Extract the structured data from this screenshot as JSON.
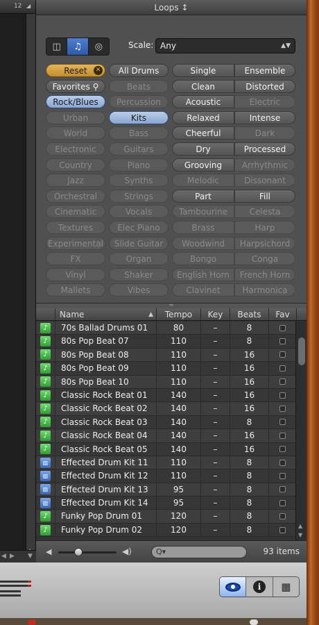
{
  "window": {
    "title": "Loops ↕"
  },
  "left_strip": {
    "col_number": "12"
  },
  "toolbar": {
    "view_buttons": [
      {
        "name": "column-view",
        "glyph": "◫",
        "active": false
      },
      {
        "name": "music-view",
        "glyph": "♫",
        "active": true
      },
      {
        "name": "podcast-view",
        "glyph": "◎",
        "active": false
      }
    ],
    "scale_label": "Scale:",
    "scale_value": "Any",
    "scale_arrows": "▲▼"
  },
  "keywords": {
    "col1": [
      {
        "label": "Reset",
        "state": "reset"
      },
      {
        "label": "Favorites",
        "state": "on"
      },
      {
        "label": "Rock/Blues",
        "state": "sel"
      },
      {
        "label": "Urban",
        "state": "off"
      },
      {
        "label": "World",
        "state": "off"
      },
      {
        "label": "Electronic",
        "state": "off"
      },
      {
        "label": "Country",
        "state": "off"
      },
      {
        "label": "Jazz",
        "state": "off"
      },
      {
        "label": "Orchestral",
        "state": "off"
      },
      {
        "label": "Cinematic",
        "state": "off"
      },
      {
        "label": "Textures",
        "state": "off"
      },
      {
        "label": "Experimental",
        "state": "off"
      },
      {
        "label": "FX",
        "state": "off"
      },
      {
        "label": "Vinyl",
        "state": "off"
      },
      {
        "label": "Mallets",
        "state": "off"
      }
    ],
    "col2": [
      {
        "label": "All Drums",
        "state": "on"
      },
      {
        "label": "Beats",
        "state": "off"
      },
      {
        "label": "Percussion",
        "state": "off"
      },
      {
        "label": "Kits",
        "state": "sel"
      },
      {
        "label": "Bass",
        "state": "off"
      },
      {
        "label": "Guitars",
        "state": "off"
      },
      {
        "label": "Piano",
        "state": "off"
      },
      {
        "label": "Synths",
        "state": "off"
      },
      {
        "label": "Strings",
        "state": "off"
      },
      {
        "label": "Vocals",
        "state": "off"
      },
      {
        "label": "Elec Piano",
        "state": "off"
      },
      {
        "label": "Slide Guitar",
        "state": "off"
      },
      {
        "label": "Organ",
        "state": "off"
      },
      {
        "label": "Shaker",
        "state": "off"
      },
      {
        "label": "Vibes",
        "state": "off"
      }
    ],
    "col3": [
      {
        "label": "Single",
        "state": "on"
      },
      {
        "label": "Clean",
        "state": "on"
      },
      {
        "label": "Acoustic",
        "state": "on"
      },
      {
        "label": "Relaxed",
        "state": "on"
      },
      {
        "label": "Cheerful",
        "state": "on"
      },
      {
        "label": "Dry",
        "state": "on"
      },
      {
        "label": "Grooving",
        "state": "on"
      },
      {
        "label": "Melodic",
        "state": "off"
      },
      {
        "label": "Part",
        "state": "on"
      },
      {
        "label": "Tambourine",
        "state": "off"
      },
      {
        "label": "Brass",
        "state": "off"
      },
      {
        "label": "Woodwind",
        "state": "off"
      },
      {
        "label": "Bongo",
        "state": "off"
      },
      {
        "label": "English Horn",
        "state": "off"
      },
      {
        "label": "Clavinet",
        "state": "off"
      }
    ],
    "col4": [
      {
        "label": "Ensemble",
        "state": "on"
      },
      {
        "label": "Distorted",
        "state": "on"
      },
      {
        "label": "Electric",
        "state": "off"
      },
      {
        "label": "Intense",
        "state": "on"
      },
      {
        "label": "Dark",
        "state": "off"
      },
      {
        "label": "Processed",
        "state": "on"
      },
      {
        "label": "Arrhythmic",
        "state": "off"
      },
      {
        "label": "Dissonant",
        "state": "off"
      },
      {
        "label": "Fill",
        "state": "on"
      },
      {
        "label": "Celesta",
        "state": "off"
      },
      {
        "label": "Harp",
        "state": "off"
      },
      {
        "label": "Harpsichord",
        "state": "off"
      },
      {
        "label": "Conga",
        "state": "off"
      },
      {
        "label": "French Horn",
        "state": "off"
      },
      {
        "label": "Harmonica",
        "state": "off"
      }
    ]
  },
  "table": {
    "columns": {
      "name": "Name",
      "tempo": "Tempo",
      "key": "Key",
      "beats": "Beats",
      "fav": "Fav"
    },
    "sort_glyph": "▲",
    "rows": [
      {
        "icon": "green",
        "name": "70s Ballad Drums 01",
        "tempo": "80",
        "key": "–",
        "beats": "8"
      },
      {
        "icon": "green",
        "name": "80s Pop Beat 07",
        "tempo": "110",
        "key": "–",
        "beats": "8"
      },
      {
        "icon": "green",
        "name": "80s Pop Beat 08",
        "tempo": "110",
        "key": "–",
        "beats": "16"
      },
      {
        "icon": "green",
        "name": "80s Pop Beat 09",
        "tempo": "110",
        "key": "–",
        "beats": "16"
      },
      {
        "icon": "green",
        "name": "80s Pop Beat 10",
        "tempo": "110",
        "key": "–",
        "beats": "16"
      },
      {
        "icon": "green",
        "name": "Classic Rock Beat 01",
        "tempo": "140",
        "key": "–",
        "beats": "16"
      },
      {
        "icon": "green",
        "name": "Classic Rock Beat 02",
        "tempo": "140",
        "key": "–",
        "beats": "16"
      },
      {
        "icon": "green",
        "name": "Classic Rock Beat 03",
        "tempo": "140",
        "key": "–",
        "beats": "8"
      },
      {
        "icon": "green",
        "name": "Classic Rock Beat 04",
        "tempo": "140",
        "key": "–",
        "beats": "16"
      },
      {
        "icon": "green",
        "name": "Classic Rock Beat 05",
        "tempo": "140",
        "key": "–",
        "beats": "16"
      },
      {
        "icon": "blue",
        "name": "Effected Drum Kit 11",
        "tempo": "110",
        "key": "–",
        "beats": "8"
      },
      {
        "icon": "blue",
        "name": "Effected Drum Kit 12",
        "tempo": "110",
        "key": "–",
        "beats": "8"
      },
      {
        "icon": "blue",
        "name": "Effected Drum Kit 13",
        "tempo": "95",
        "key": "–",
        "beats": "8"
      },
      {
        "icon": "blue",
        "name": "Effected Drum Kit 14",
        "tempo": "95",
        "key": "–",
        "beats": "8"
      },
      {
        "icon": "green",
        "name": "Funky Pop Drum 01",
        "tempo": "120",
        "key": "–",
        "beats": "8"
      },
      {
        "icon": "green",
        "name": "Funky Pop Drum 02",
        "tempo": "120",
        "key": "–",
        "beats": "8"
      }
    ]
  },
  "footer": {
    "search_glyph": "Q▾",
    "search_placeholder": "",
    "volume_fraction": 0.35,
    "items_count": "93 items"
  },
  "bottom_buttons": [
    {
      "name": "loop-browser",
      "active": true
    },
    {
      "name": "track-info",
      "active": false
    },
    {
      "name": "media-browser",
      "active": false
    }
  ],
  "colors": {
    "selected_blue": "#8aa6d0",
    "reset_gold": "#c28d2f",
    "loop_green": "#2f9d2f",
    "loop_blue": "#3b67b5"
  }
}
